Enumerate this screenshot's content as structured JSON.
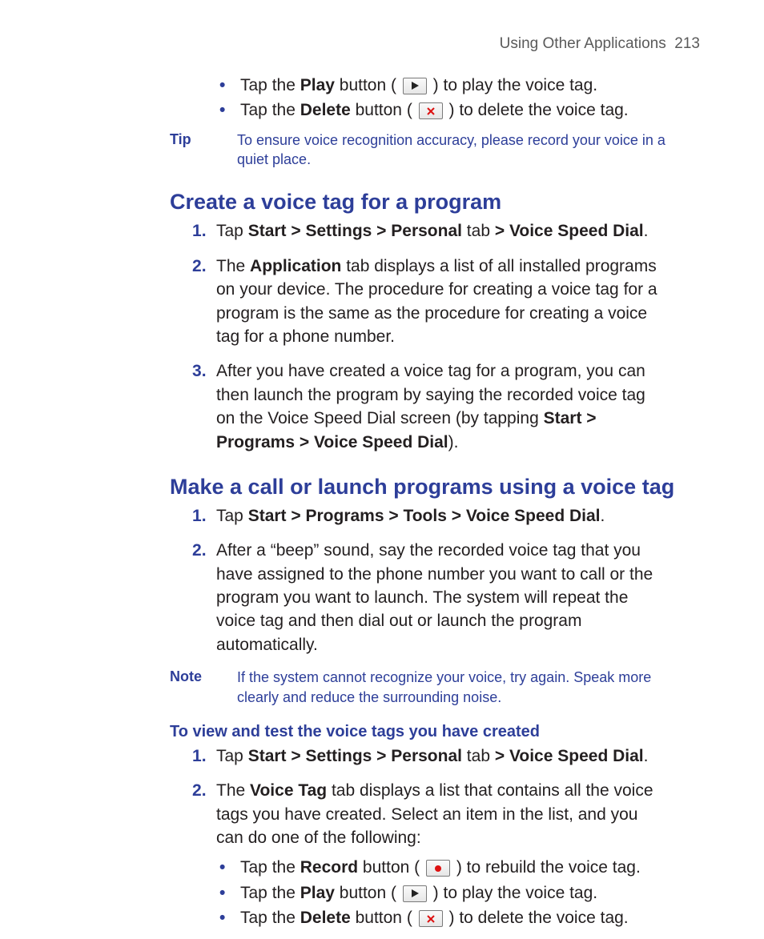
{
  "header": {
    "section": "Using Other Applications",
    "page": "213"
  },
  "intro_bullets": [
    {
      "pre": "Tap the ",
      "bold": "Play",
      "mid": " button ( ",
      "icon": "play",
      "post": " ) to play the voice tag."
    },
    {
      "pre": "Tap the ",
      "bold": "Delete",
      "mid": " button ( ",
      "icon": "delete",
      "post": " ) to delete the voice tag."
    }
  ],
  "tip": {
    "label": "Tip",
    "text": "To ensure voice recognition accuracy, please record your voice in a quiet place."
  },
  "section1": {
    "title": "Create a voice tag for a program",
    "items": [
      {
        "t1": "Tap ",
        "b1": "Start > Settings > Personal",
        "t2": " tab ",
        "b2": "> Voice Speed Dial",
        "t3": "."
      },
      {
        "t1": "The ",
        "b1": "Application",
        "t2": " tab displays a list of all installed programs on your device. The procedure for creating a voice tag for a program is the same as the procedure for creating a voice tag for a phone number."
      },
      {
        "t1": "After you have created a voice tag for a program, you can then launch the program by saying the recorded voice tag on the Voice Speed Dial screen (by tapping ",
        "b1": "Start > Programs > Voice Speed Dial",
        "t2": ")."
      }
    ]
  },
  "section2": {
    "title": "Make a call or launch programs using a voice tag",
    "items": [
      {
        "t1": "Tap ",
        "b1": "Start > Programs > Tools > Voice Speed Dial",
        "t2": "."
      },
      {
        "t1": "After a “beep” sound, say the recorded voice tag that you have assigned to the phone number you want to call or the program you want to launch. The system will repeat the voice tag and then dial out or launch the program automatically."
      }
    ]
  },
  "note": {
    "label": "Note",
    "text": "If the system cannot recognize your voice, try again. Speak more clearly and reduce the surrounding noise."
  },
  "sub": {
    "title": "To view and test the voice tags you have created",
    "items": [
      {
        "t1": "Tap ",
        "b1": "Start > Settings > Personal",
        "t2": " tab ",
        "b2": "> Voice Speed Dial",
        "t3": "."
      },
      {
        "t1": "The ",
        "b1": "Voice Tag",
        "t2": " tab displays a list that contains all the voice tags you have created. Select an item in the list, and you can do one of the following:"
      }
    ],
    "bullets": [
      {
        "pre": "Tap the ",
        "bold": "Record",
        "mid": " button ( ",
        "icon": "record",
        "post": " ) to rebuild the voice tag."
      },
      {
        "pre": "Tap the ",
        "bold": "Play",
        "mid": " button ( ",
        "icon": "play",
        "post": " ) to play the voice tag."
      },
      {
        "pre": "Tap the ",
        "bold": "Delete",
        "mid": " button ( ",
        "icon": "delete",
        "post": " ) to delete the voice tag."
      }
    ]
  }
}
